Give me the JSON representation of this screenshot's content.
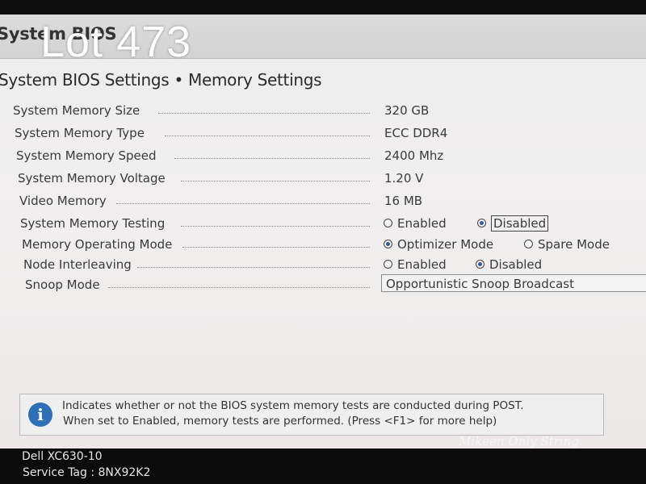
{
  "header": {
    "app_title": "System BIOS",
    "overlay": "Lot 473"
  },
  "breadcrumb": "System BIOS Settings • Memory Settings",
  "settings": [
    {
      "label": "System Memory Size",
      "value": "320 GB"
    },
    {
      "label": "System Memory Type",
      "value": "ECC DDR4"
    },
    {
      "label": "System Memory Speed",
      "value": "2400 Mhz"
    },
    {
      "label": "System Memory Voltage",
      "value": "1.20 V"
    },
    {
      "label": "Video Memory",
      "value": "16 MB"
    },
    {
      "label": "System Memory Testing",
      "options": [
        "Enabled",
        "Disabled"
      ],
      "selected": "Disabled"
    },
    {
      "label": "Memory Operating Mode",
      "options": [
        "Optimizer Mode",
        "Spare Mode"
      ],
      "selected": "Optimizer Mode"
    },
    {
      "label": "Node Interleaving",
      "options": [
        "Enabled",
        "Disabled"
      ],
      "selected": "Disabled"
    },
    {
      "label": "Snoop Mode",
      "value": "Opportunistic Snoop Broadcast"
    }
  ],
  "help": {
    "icon": "info-icon",
    "line1": "Indicates whether or not the BIOS system memory tests are conducted during POST.",
    "line2": "When set to Enabled, memory tests are performed. (Press <F1> for more help)"
  },
  "watermark": "Mikeen Only String",
  "footer": {
    "model": "Dell XC630-10",
    "service_tag": "Service Tag : 8NX92K2"
  },
  "colors": {
    "radio_selected": "#2e58a6",
    "info_icon": "#2f6fb8"
  }
}
